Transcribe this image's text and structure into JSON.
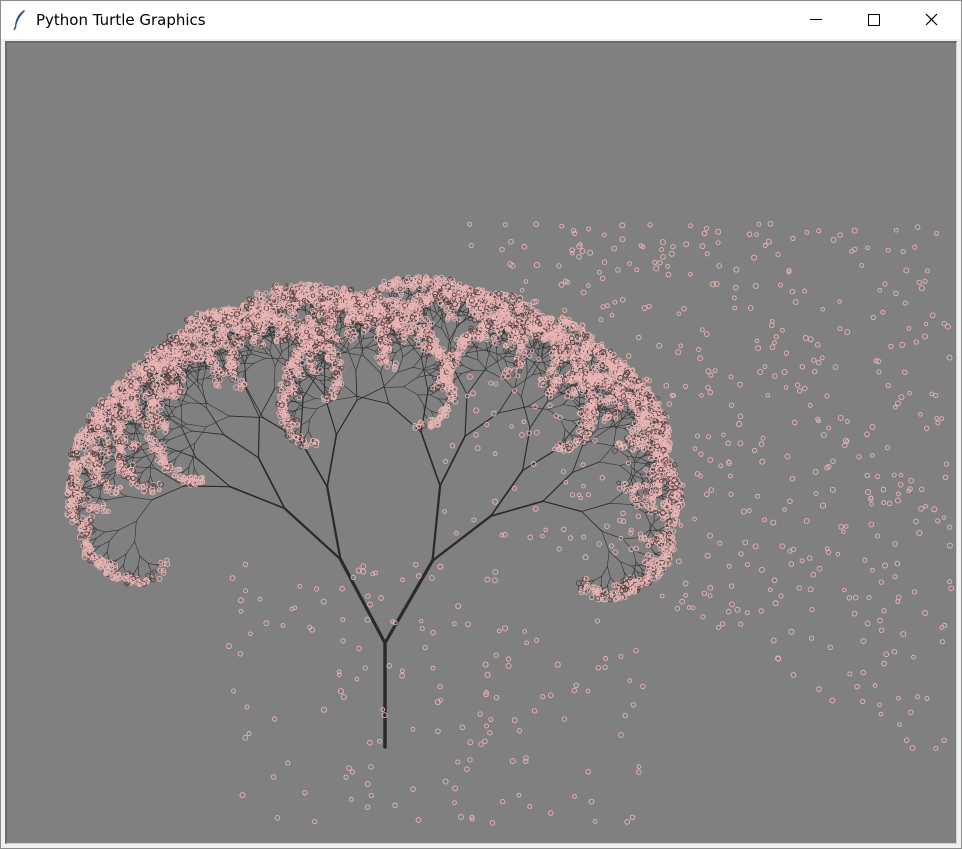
{
  "window": {
    "title": "Python Turtle Graphics",
    "app_icon": "feather-icon",
    "controls": {
      "minimize": "minimize-icon",
      "maximize": "maximize-icon",
      "close": "close-icon"
    }
  },
  "canvas": {
    "background_color": "#808080",
    "trunk_color": "#2b2b2b",
    "branch_color": "#303030",
    "blossom_color": "#e8b4b4",
    "blossom_dark_color": "#5a4646"
  }
}
